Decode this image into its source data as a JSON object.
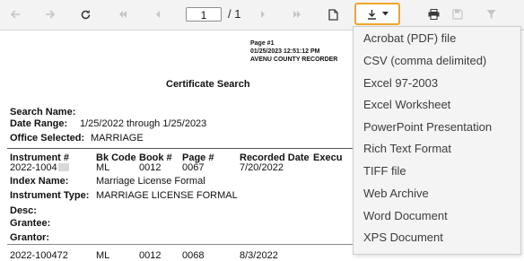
{
  "toolbar": {
    "current_page": "1",
    "page_total": "/ 1",
    "icons": {
      "back": "arrow-left-icon",
      "forward": "arrow-right-icon",
      "refresh": "refresh-icon",
      "first_page": "first-page-icon",
      "previous_page": "previous-page-icon",
      "next_page": "next-page-icon",
      "last_page": "last-page-icon",
      "page_setup": "page-icon",
      "export": "download-icon",
      "export_dropdown": "caret-down-icon",
      "print": "print-icon",
      "save": "save-icon",
      "filter": "filter-icon"
    },
    "accent_color": "#f0a529"
  },
  "report": {
    "header": {
      "page_label": "Page #1",
      "timestamp": "01/25/2023 12:51:12 PM",
      "office": "AVENU COUNTY RECORDER"
    },
    "title": "Certificate Search",
    "search_name_label": "Search Name:",
    "date_range_label": "Date Range:",
    "date_range_value": "1/25/2022 through 1/25/2023",
    "office_selected_label": "Office Selected:",
    "office_selected_value": "MARRIAGE",
    "columns": {
      "instrument": "Instrument #",
      "bk_code": "Bk Code",
      "book": "Book #",
      "page": "Page #",
      "recorded_date": "Recorded Date",
      "executed": "Execu"
    },
    "records": [
      {
        "instrument": "2022-1004",
        "bk_code": "ML",
        "book": "0012",
        "page": "0067",
        "recorded_date": "7/20/2022",
        "index_name_label": "Index Name:",
        "index_name": "Marriage License Formal",
        "instrument_type_label": "Instrument Type:",
        "instrument_type": "MARRIAGE LICENSE FORMAL",
        "desc_label": "Desc:",
        "grantee_label": "Grantee:",
        "grantor_label": "Grantor:"
      },
      {
        "instrument": "2022-100472",
        "bk_code": "ML",
        "book": "0012",
        "page": "0068",
        "recorded_date": "8/3/2022"
      }
    ]
  },
  "export_menu": {
    "items": [
      "Acrobat (PDF) file",
      "CSV (comma delimited)",
      "Excel 97-2003",
      "Excel Worksheet",
      "PowerPoint Presentation",
      "Rich Text Format",
      "TIFF file",
      "Web Archive",
      "Word Document",
      "XPS Document"
    ]
  }
}
